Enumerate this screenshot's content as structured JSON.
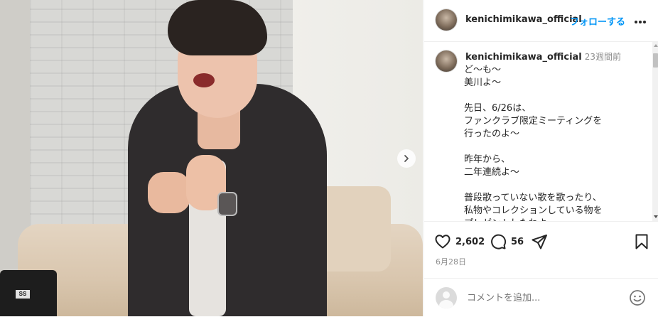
{
  "post": {
    "photo_alt": "",
    "equipment_label": "SS"
  },
  "header": {
    "username": "kenichimikawa_official",
    "follow_label": "フォローする"
  },
  "caption": {
    "username": "kenichimikawa_official",
    "time": "23週間前",
    "lines": [
      "ど〜も〜",
      "美川よ〜",
      "",
      "先日、6/26は、",
      "ファンクラブ限定ミーティングを",
      "行ったのよ〜",
      "",
      "昨年から、",
      "二年連続よ〜",
      "",
      "普段歌っていない歌を歌ったり、",
      "私物やコレクションしている物を",
      "プレゼントしたわよ〜"
    ]
  },
  "actions": {
    "likes": "2,602",
    "comments": "56",
    "date": "6月28日"
  },
  "comment_box": {
    "placeholder": "コメントを追加..."
  },
  "colors": {
    "accent": "#0095f6",
    "text": "#262626",
    "muted": "#8e8e8e"
  },
  "icons": [
    "chevron-right-icon",
    "more-icon",
    "heart-icon",
    "comment-icon",
    "share-icon",
    "bookmark-icon",
    "emoji-icon"
  ]
}
